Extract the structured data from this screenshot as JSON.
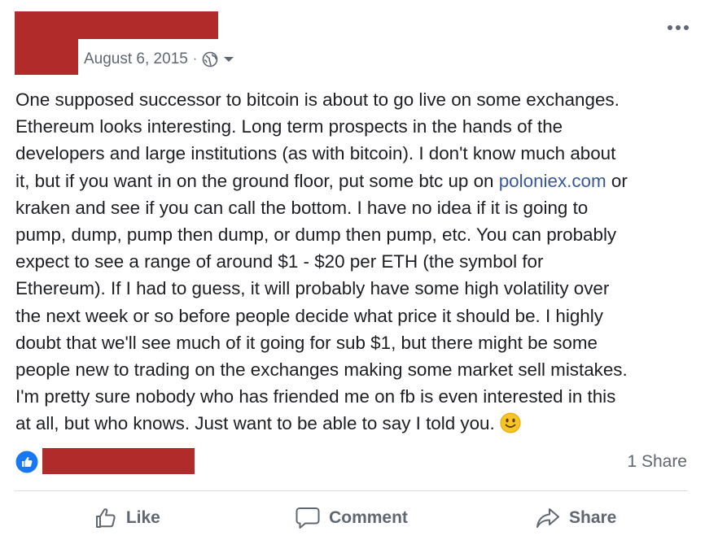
{
  "post": {
    "date": "August 6, 2015",
    "separator": "·",
    "privacy_icon": "globe-icon",
    "audience_menu_icon": "chevron-down-icon",
    "more_icon": "more-horizontal-icon",
    "body_lines": [
      "One supposed successor to bitcoin is about to go live on some exchanges.",
      "Ethereum looks interesting. Long term prospects in the hands of the",
      "developers and large institutions (as with bitcoin). I don't know much about",
      "it, but if you want in on the ground floor, put some btc up on ",
      "kraken and see if you can call the bottom. I have no idea if it is going to",
      "pump, dump, pump then dump, or dump then pump, etc. You can probably",
      "expect to see a range of around $1 - $20 per ETH (the symbol for",
      "Ethereum). If I had to guess, it will probably have some high volatility over",
      "the next week or so before people decide what price it should be. I highly",
      "doubt that we'll see much of it going for sub $1, but there might be some",
      "people new to trading on the exchanges making some market sell mistakes.",
      "I'm pretty sure nobody who has friended me on fb is even interested in this",
      "at all, but who knows. Just want to be able to say I told you."
    ],
    "link_text": "poloniex.com",
    "link_suffix": " or",
    "emoji": "slightly-smiling-face"
  },
  "reactions": {
    "icon": "like-badge-icon",
    "share_count": "1 Share"
  },
  "actions": {
    "like": "Like",
    "comment": "Comment",
    "share": "Share"
  },
  "colors": {
    "redaction": "#b22b2b",
    "link": "#385898",
    "secondary_text": "#606770",
    "like_blue": "#1877f2",
    "emoji_yellow": "#f7c325"
  }
}
